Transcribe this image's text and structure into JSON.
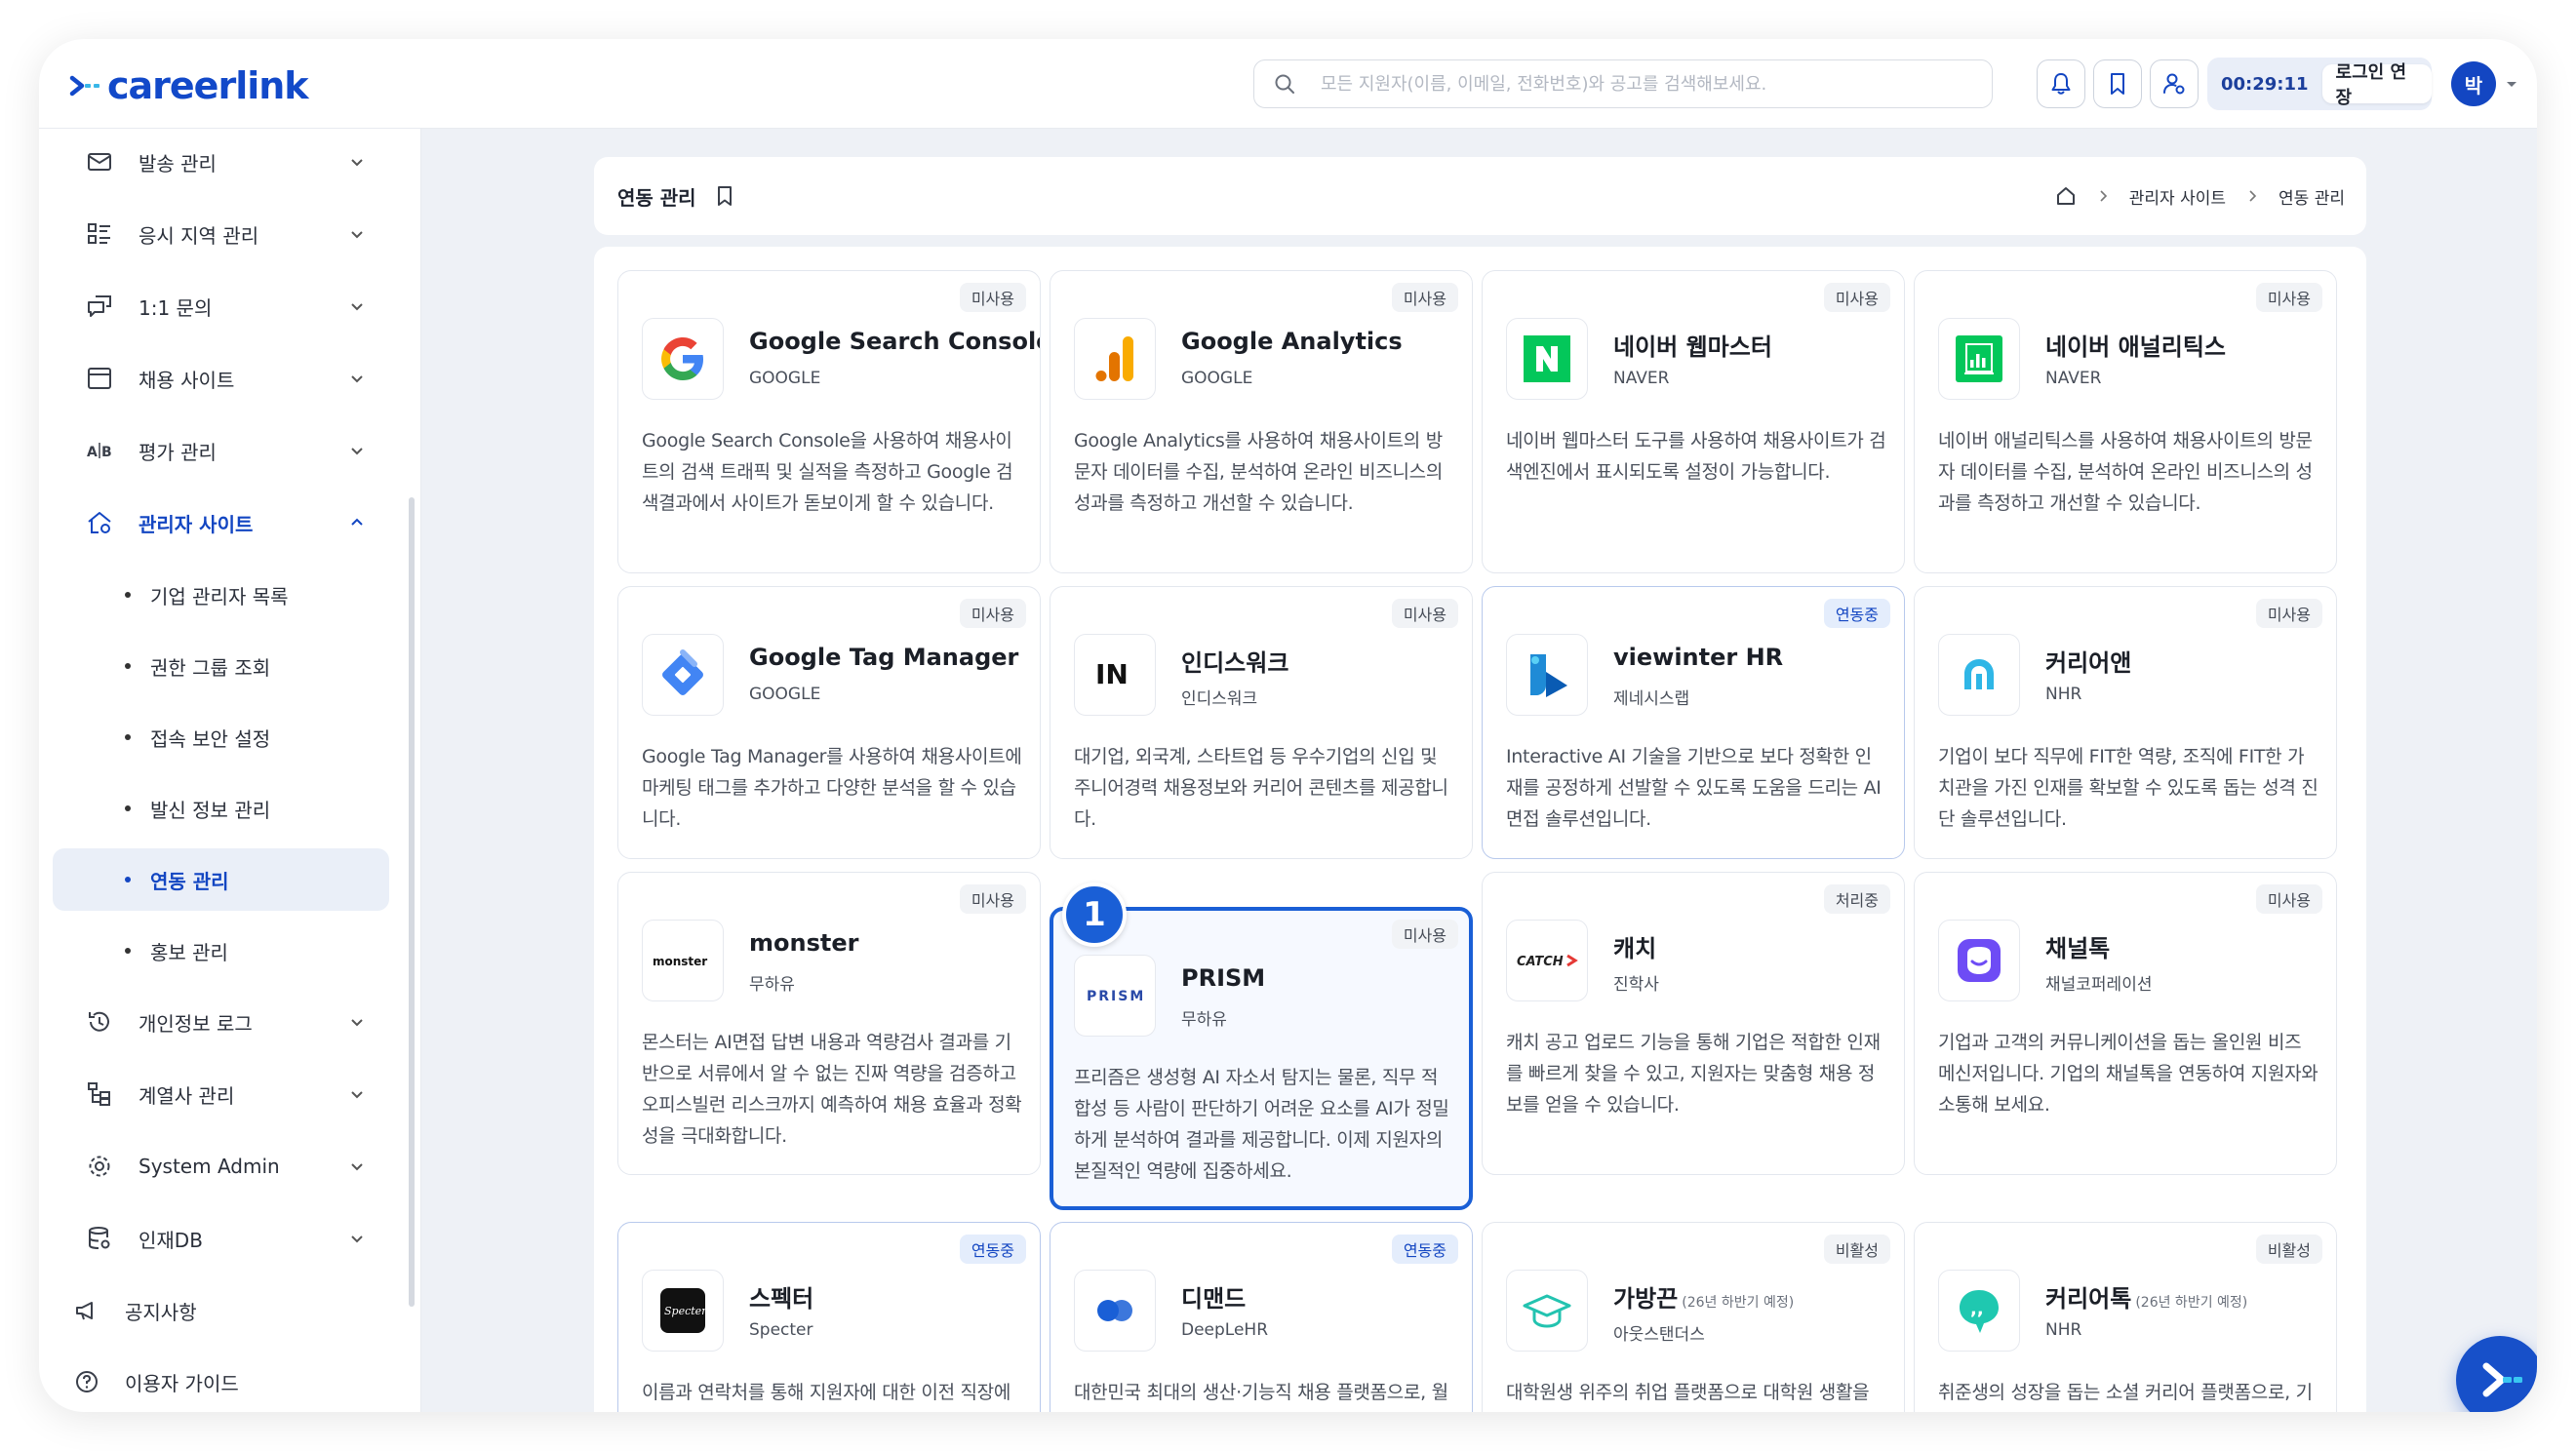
{
  "brand": {
    "name": "careerlink",
    "color": "#1249c9"
  },
  "search": {
    "placeholder": "모든 지원자(이름, 이메일, 전화번호)와 공고를 검색해보세요."
  },
  "session": {
    "timer": "00:29:11",
    "extend_label": "로그인 연장"
  },
  "user": {
    "avatar_initial": "박"
  },
  "sidebar": {
    "items": [
      {
        "label": "발송 관리",
        "icon": "mail-icon"
      },
      {
        "label": "응시 지역 관리",
        "icon": "list-icon"
      },
      {
        "label": "1:1 문의",
        "icon": "chat-icon"
      },
      {
        "label": "채용 사이트",
        "icon": "browser-icon"
      },
      {
        "label": "평가 관리",
        "icon": "ab-test-icon"
      },
      {
        "label": "관리자 사이트",
        "icon": "home-settings-icon"
      }
    ],
    "sub_items": [
      {
        "label": "기업 관리자 목록"
      },
      {
        "label": "권한 그룹 조회"
      },
      {
        "label": "접속 보안 설정"
      },
      {
        "label": "발신 정보 관리"
      },
      {
        "label": "연동 관리"
      },
      {
        "label": "홍보 관리"
      }
    ],
    "items_after": [
      {
        "label": "개인정보 로그",
        "icon": "history-icon"
      },
      {
        "label": "계열사 관리",
        "icon": "tree-icon"
      },
      {
        "label": "System Admin",
        "icon": "gear-icon"
      },
      {
        "label": "인재DB",
        "icon": "database-icon"
      }
    ],
    "bottom": [
      {
        "label": "공지사항",
        "icon": "megaphone-icon"
      },
      {
        "label": "이용자 가이드",
        "icon": "help-icon"
      }
    ]
  },
  "header": {
    "page_title": "연동 관리",
    "breadcrumb": [
      "관리자 사이트",
      "연동 관리"
    ]
  },
  "status_labels": {
    "unused": "미사용",
    "linked": "연동중",
    "processing": "처리중",
    "inactive": "비활성"
  },
  "cards": [
    {
      "name": "Google Search Console",
      "vendor": "GOOGLE",
      "status": "미사용",
      "desc": "Google Search Console을 사용하여 채용사이트의 검색 트래픽 및 실적을 측정하고 Google 검색결과에서 사이트가 돋보이게 할 수 있습니다."
    },
    {
      "name": "Google Analytics",
      "vendor": "GOOGLE",
      "status": "미사용",
      "desc": "Google Analytics를 사용하여 채용사이트의 방문자 데이터를 수집, 분석하여 온라인 비즈니스의 성과를 측정하고 개선할 수 있습니다."
    },
    {
      "name": "네이버 웹마스터",
      "vendor": "NAVER",
      "status": "미사용",
      "desc": "네이버 웹마스터 도구를 사용하여 채용사이트가 검색엔진에서 표시되도록 설정이 가능합니다."
    },
    {
      "name": "네이버 애널리틱스",
      "vendor": "NAVER",
      "status": "미사용",
      "desc": "네이버 애널리틱스를 사용하여 채용사이트의 방문자 데이터를 수집, 분석하여 온라인 비즈니스의 성과를 측정하고 개선할 수 있습니다."
    },
    {
      "name": "Google Tag Manager",
      "vendor": "GOOGLE",
      "status": "미사용",
      "desc": "Google Tag Manager를 사용하여 채용사이트에 마케팅 태그를 추가하고 다양한 분석을 할 수 있습니다."
    },
    {
      "name": "인디스워크",
      "vendor": "인디스워크",
      "status": "미사용",
      "desc": "대기업, 외국계, 스타트업 등 우수기업의 신입 및 주니어경력 채용정보와 커리어 콘텐츠를 제공합니다."
    },
    {
      "name": "viewinter HR",
      "vendor": "제네시스랩",
      "status": "연동중",
      "desc": "Interactive AI 기술을 기반으로 보다 정확한 인재를 공정하게 선발할 수 있도록 도움을 드리는 AI 면접 솔루션입니다."
    },
    {
      "name": "커리어앤",
      "vendor": "NHR",
      "status": "미사용",
      "desc": "기업이 보다 직무에 FIT한 역량, 조직에 FIT한 가치관을 가진 인재를 확보할 수 있도록 돕는 성격 진단 솔루션입니다."
    },
    {
      "name": "monster",
      "vendor": "무하유",
      "status": "미사용",
      "desc": "몬스터는 AI면접 답변 내용과 역량검사 결과를 기반으로 서류에서 알 수 없는 진짜 역량을 검증하고 오피스빌런 리스크까지 예측하여 채용 효율과 정확성을 극대화합니다."
    },
    {
      "name": "PRISM",
      "vendor": "무하유",
      "status": "미사용",
      "desc": "프리즘은 생성형 AI 자소서 탐지는 물론, 직무 적합성 등 사람이 판단하기 어려운 요소를 AI가 정밀하게 분석하여 결과를 제공합니다. 이제 지원자의 본질적인 역량에 집중하세요."
    },
    {
      "name": "캐치",
      "vendor": "진학사",
      "status": "처리중",
      "desc": "캐치 공고 업로드 기능을 통해 기업은 적합한 인재를 빠르게 찾을 수 있고, 지원자는 맞춤형 채용 정보를 얻을 수 있습니다."
    },
    {
      "name": "채널톡",
      "vendor": "채널코퍼레이션",
      "status": "미사용",
      "desc": "기업과 고객의 커뮤니케이션을 돕는 올인원 비즈 메신저입니다. 기업의 채널톡을 연동하여 지원자와 소통해 보세요."
    },
    {
      "name": "스펙터",
      "vendor": "Specter",
      "status": "연동중",
      "desc": "이름과 연락처를 통해 지원자에 대한 이전 직장에서의 평판을 열람하거나 조회할 수 있습니다."
    },
    {
      "name": "디맨드",
      "vendor": "DeepLeHR",
      "status": "연동중",
      "desc": "대한민국 최대의 생산·기능직 채용 플랫폼으로, 월간 활성자 수 약 15만 명과 월 평균 총 조회수 약 80만 회를 보유하고 있습니다."
    },
    {
      "name": "가방끈",
      "note": "(26년 하반기 예정)",
      "vendor": "아웃스탠더스",
      "status": "비활성",
      "desc": "대학원생 위주의 취업 플랫폼으로 대학원 생활을 하는 사람들의 소통 창구이자 취업 정보를 제공하고 있습니다."
    },
    {
      "name": "커리어톡",
      "note": "(26년 하반기 예정)",
      "vendor": "NHR",
      "status": "비활성",
      "desc": "취준생의 성장을 돕는 소셜 커리어 플랫폼으로, 기업과 신입 구직자를 쉽고 편하게 만날 수 있도록 연결합니다."
    }
  ],
  "annotation": {
    "marker": "1"
  }
}
